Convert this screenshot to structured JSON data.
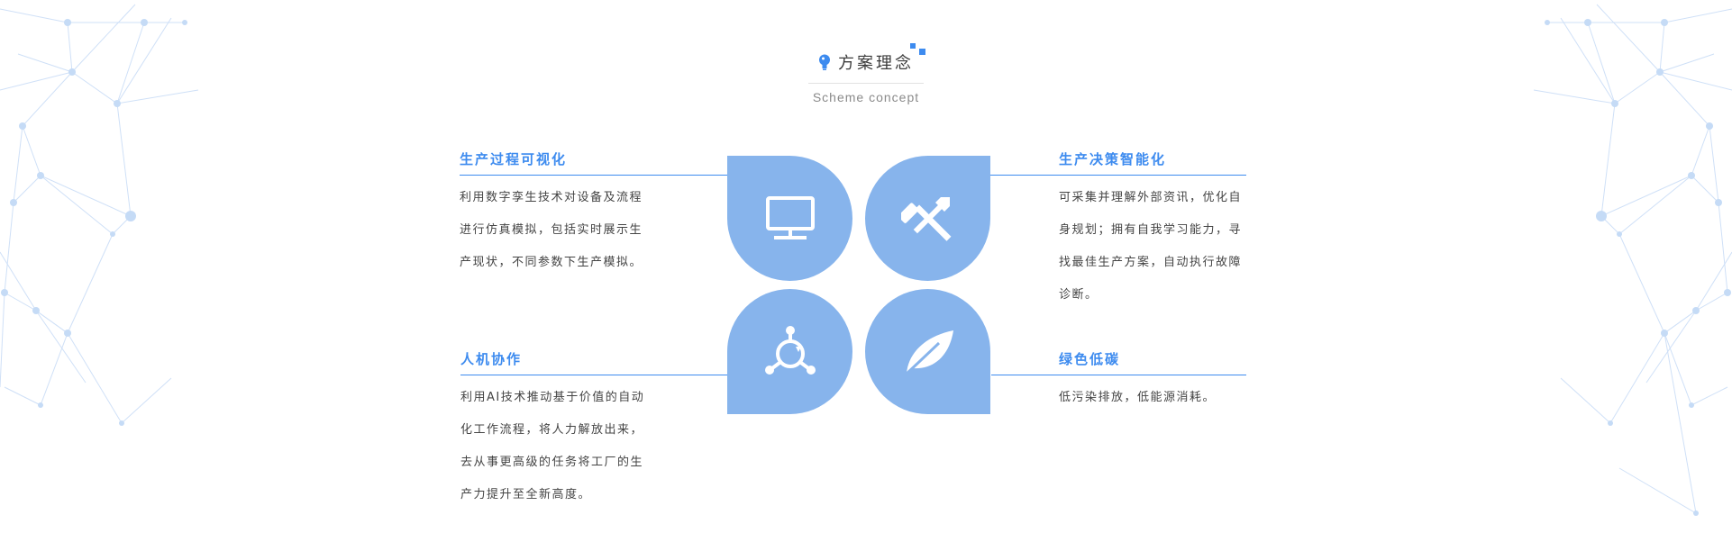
{
  "header": {
    "title": "方案理念",
    "subtitle": "Scheme concept",
    "title_icon": "lightbulb-icon"
  },
  "sections": {
    "visualization": {
      "title": "生产过程可视化",
      "lines": [
        "利用数字孪生技术对设备及流程",
        "进行仿真模拟，包括实时展示生",
        "产现状，不同参数下生产模拟。"
      ],
      "icon": "monitor-icon"
    },
    "intelligence": {
      "title": "生产决策智能化",
      "lines": [
        "可采集并理解外部资讯，优化自",
        "身规划；拥有自我学习能力，寻",
        "找最佳生产方案，自动执行故障",
        "诊断。"
      ],
      "icon": "tools-icon"
    },
    "collaboration": {
      "title": "人机协作",
      "lines": [
        "利用AI技术推动基于价值的自动",
        "化工作流程，将人力解放出来，",
        "去从事更高级的任务将工厂的生",
        "产力提升至全新高度。"
      ],
      "icon": "network-cycle-icon"
    },
    "green": {
      "title": "绿色低碳",
      "lines": [
        "低污染排放，低能源消耗。"
      ],
      "icon": "leaf-icon"
    }
  },
  "colors": {
    "accent": "#3d8bef",
    "petal": "#87b4ec",
    "text": "#444444"
  }
}
